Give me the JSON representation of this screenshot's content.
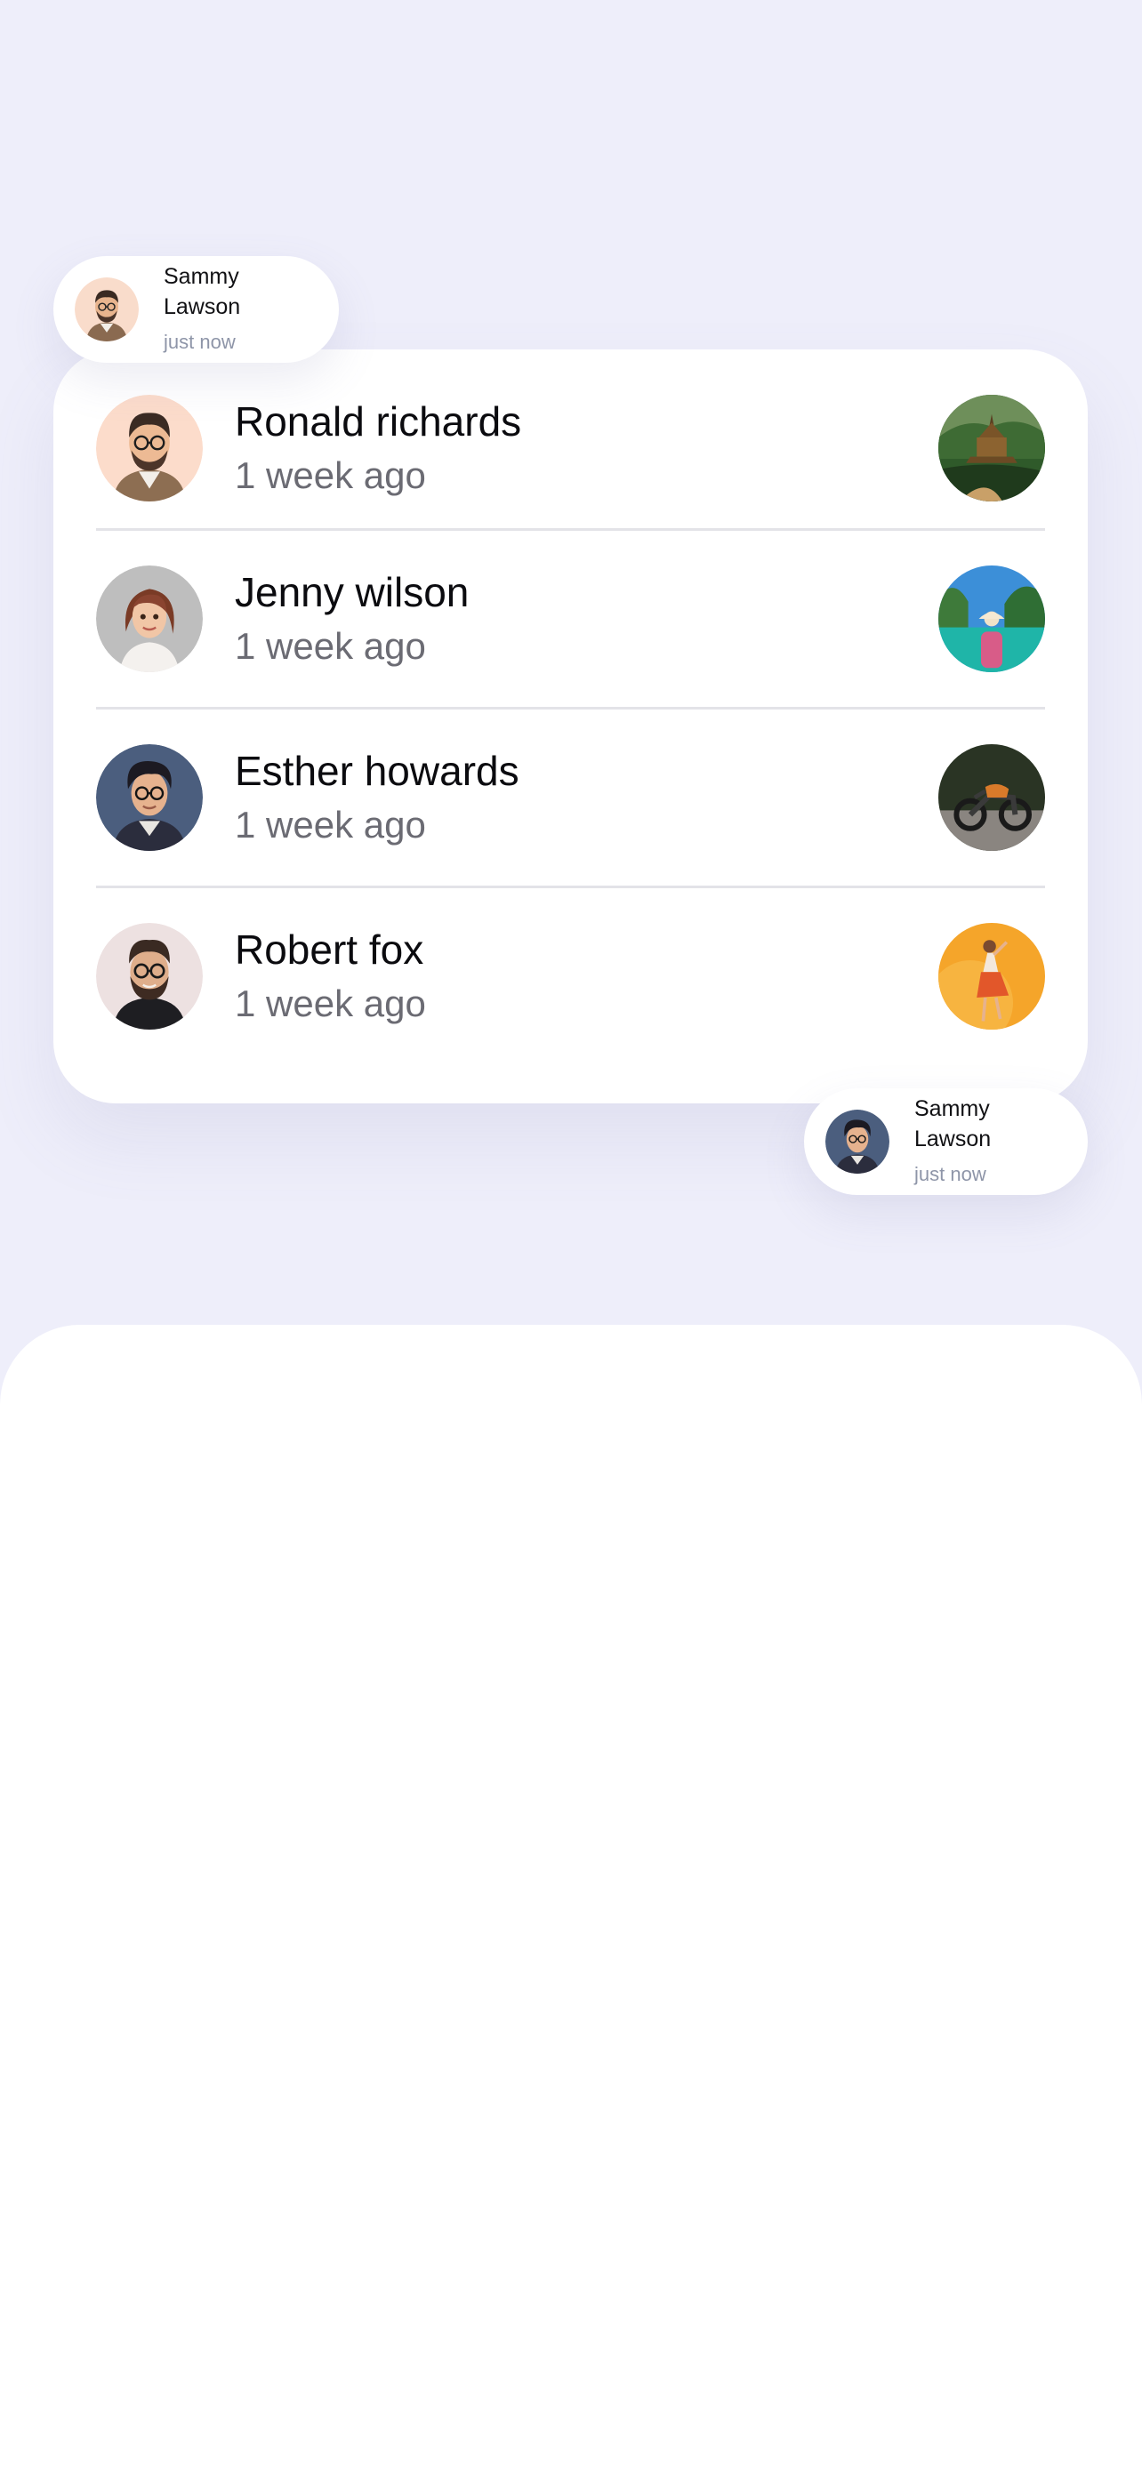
{
  "notifications": [
    {
      "name": "Sammy Lawson",
      "time": "just now"
    },
    {
      "name": "Sammy Lawson",
      "time": "just now"
    }
  ],
  "feed": {
    "items": [
      {
        "name": "Ronald richards",
        "time": "1 week ago",
        "avatar_icon": "man-glasses-beard-avatar",
        "thumb_icon": "temple-photo-thumbnail"
      },
      {
        "name": "Jenny wilson",
        "time": "1 week ago",
        "avatar_icon": "woman-avatar",
        "thumb_icon": "boat-lagoon-photo-thumbnail"
      },
      {
        "name": "Esther howards",
        "time": "1 week ago",
        "avatar_icon": "man-glasses-hoodie-avatar",
        "thumb_icon": "motorcycle-photo-thumbnail"
      },
      {
        "name": "Robert fox",
        "time": "1 week ago",
        "avatar_icon": "man-glasses-beard-avatar",
        "thumb_icon": "dancer-photo-thumbnail"
      }
    ]
  },
  "colors": {
    "background": "#EEEEFA",
    "card": "#FFFFFF",
    "name_text": "#0B0B0F",
    "time_text": "#6B6B73",
    "toast_time_text": "#8E95A8",
    "divider": "#E3E3E8"
  }
}
